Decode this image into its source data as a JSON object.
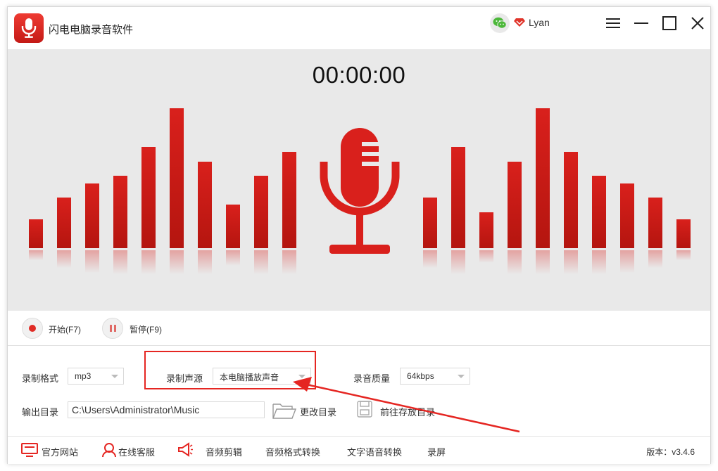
{
  "window": {
    "title": "闪电电脑录音软件",
    "user": "Lyan"
  },
  "visual": {
    "timer": "00:00:00",
    "accent": "#d9201c",
    "left_bar_levels": [
      0.2,
      0.35,
      0.45,
      0.5,
      0.7,
      0.97,
      0.6,
      0.3,
      0.5,
      0.67
    ],
    "right_bar_levels": [
      0.35,
      0.7,
      0.25,
      0.6,
      0.97,
      0.67,
      0.5,
      0.45,
      0.35,
      0.2
    ]
  },
  "controls": {
    "start_label": "开始(F7)",
    "pause_label": "暂停(F9)"
  },
  "settings": {
    "format_label": "录制格式",
    "format_value": "mp3",
    "source_label": "录制声源",
    "source_value": "本电脑播放声音",
    "quality_label": "录音质量",
    "quality_value": "64kbps",
    "output_label": "输出目录",
    "output_path": "C:\\Users\\Administrator\\Music",
    "change_dir_label": "更改目录",
    "open_dir_label": "前往存放目录"
  },
  "footer": {
    "website": "官方网站",
    "support": "在线客服",
    "audio_cut": "音频剪辑",
    "format_convert": "音频格式转换",
    "tts": "文字语音转换",
    "screen_record": "录屏",
    "version": "版本：v3.4.6"
  }
}
